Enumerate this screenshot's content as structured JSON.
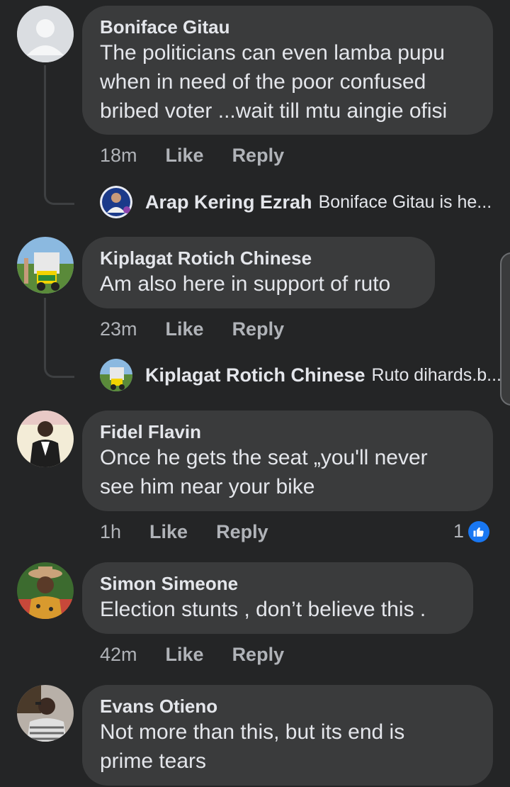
{
  "comments": [
    {
      "author": "Boniface Gitau",
      "lines": [
        "The politicians can even lamba pupu",
        "when in need of the poor confused",
        "bribed voter ...wait till mtu aingie ofisi"
      ],
      "time": "18m",
      "like_label": "Like",
      "reply_label": "Reply",
      "reply": {
        "author": "Arap Kering Ezrah",
        "snippet": "Boniface Gitau is he..."
      }
    },
    {
      "author": "Kiplagat Rotich Chinese",
      "lines": [
        "Am also here in support of ruto"
      ],
      "time": "23m",
      "like_label": "Like",
      "reply_label": "Reply",
      "reply": {
        "author": "Kiplagat Rotich Chinese",
        "snippet": "Ruto dihards.b..."
      }
    },
    {
      "author": "Fidel Flavin",
      "lines": [
        "Once he gets the seat „you'll never",
        "see him near your bike"
      ],
      "time": "1h",
      "like_label": "Like",
      "reply_label": "Reply",
      "reactions": {
        "count": "1",
        "icon": "thumbs-up-icon"
      }
    },
    {
      "author": "Simon Simeone",
      "lines": [
        "Election stunts , don’t believe this ."
      ],
      "time": "42m",
      "like_label": "Like",
      "reply_label": "Reply"
    },
    {
      "author": "Evans Otieno",
      "lines": [
        "Not more than this, but its end is",
        "prime tears"
      ]
    }
  ],
  "colors": {
    "background": "#242526",
    "bubble": "#3a3b3c",
    "text": "#e4e6eb",
    "meta": "#b0b3b8",
    "like_blue": "#1877f2"
  }
}
